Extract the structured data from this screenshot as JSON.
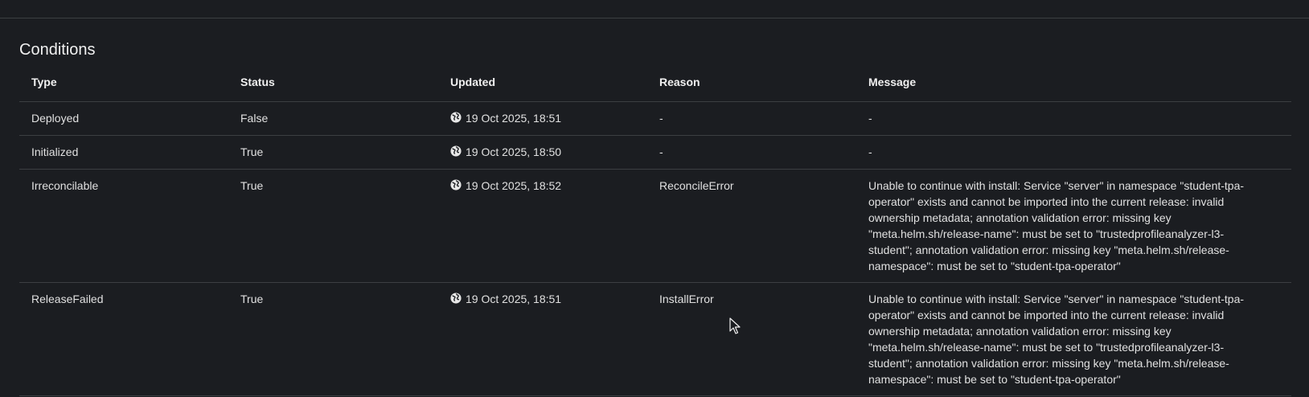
{
  "section": {
    "title": "Conditions"
  },
  "table": {
    "headers": [
      "Type",
      "Status",
      "Updated",
      "Reason",
      "Message"
    ],
    "rows": [
      {
        "type": "Deployed",
        "status": "False",
        "updated": "19 Oct 2025, 18:51",
        "reason": "-",
        "message": "-"
      },
      {
        "type": "Initialized",
        "status": "True",
        "updated": "19 Oct 2025, 18:50",
        "reason": "-",
        "message": "-"
      },
      {
        "type": "Irreconcilable",
        "status": "True",
        "updated": "19 Oct 2025, 18:52",
        "reason": "ReconcileError",
        "message": "Unable to continue with install: Service \"server\" in namespace \"student-tpa-operator\" exists and cannot be imported into the current release: invalid ownership metadata; annotation validation error: missing key \"meta.helm.sh/release-name\": must be set to \"trustedprofileanalyzer-l3-student\"; annotation validation error: missing key \"meta.helm.sh/release-namespace\": must be set to \"student-tpa-operator\""
      },
      {
        "type": "ReleaseFailed",
        "status": "True",
        "updated": "19 Oct 2025, 18:51",
        "reason": "InstallError",
        "message": "Unable to continue with install: Service \"server\" in namespace \"student-tpa-operator\" exists and cannot be imported into the current release: invalid ownership metadata; annotation validation error: missing key \"meta.helm.sh/release-name\": must be set to \"trustedprofileanalyzer-l3-student\"; annotation validation error: missing key \"meta.helm.sh/release-namespace\": must be set to \"student-tpa-operator\""
      }
    ]
  },
  "icons": {
    "updated": "globe-icon",
    "pointer": "mouse-cursor-icon"
  },
  "colors": {
    "background": "#1b1d21",
    "divider": "#3c3f42",
    "text": "#e0e0e0"
  }
}
